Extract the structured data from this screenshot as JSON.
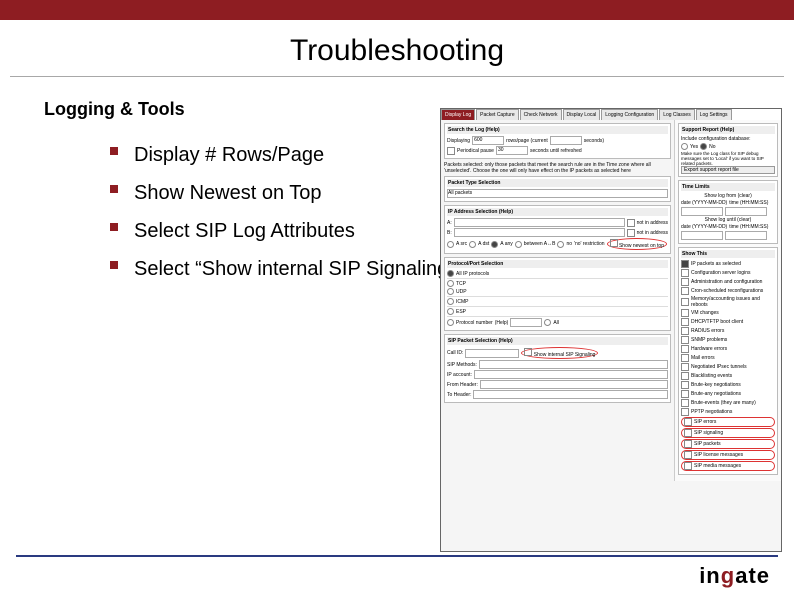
{
  "title": "Troubleshooting",
  "section": "Logging & Tools",
  "bullets": [
    "Display # Rows/Page",
    "Show Newest on Top",
    "Select SIP Log Attributes",
    "Select “Show internal SIP Signaling”"
  ],
  "scr": {
    "tabs": [
      "Display Log",
      "Packet Capture",
      "Check Network",
      "Display Local",
      "Logging Configuration",
      "Log Classes",
      "Log Settings"
    ],
    "search_title": "Search the Log",
    "displaying_label": "Displaying",
    "displaying_value": "600",
    "rows_label": "rows/page (current",
    "seconds_guess": "seconds)",
    "periodic": "Periodical pause",
    "periodic_val": "30",
    "periodic_after": "seconds until refreshed",
    "search_note": "Packets selected: only those packets that meet the search rule are in the Time zone where all 'unselected'. Choose the one will only have effect on the IP packets as selected here",
    "help": "(Help)",
    "pkt_type_title": "Packet Type Selection",
    "pkt_type_sel": "All packets",
    "ip_title": "IP Address Selection",
    "ip_a": "A:",
    "ip_b": "B:",
    "ip_chk_a": "not in address",
    "ip_chk_b": "not in address",
    "asrc": "A src",
    "adst": "A dst",
    "aany": "A any",
    "between": "between A↔B",
    "no": "no",
    "no_restrict": "'no' restriction",
    "newest": "Show newest on top",
    "proto_title": "Protocol/Port Selection",
    "all_ip": "All IP protocols",
    "tcp": "TCP",
    "udp": "UDP",
    "icmp": "ICMP",
    "esp": "ESP",
    "proto_num": "Protocol number",
    "all": "All",
    "sip_title": "SIP Packet Selection",
    "callid": "Call ID:",
    "sipm": "SIP Methods:",
    "ipacc": "IP account:",
    "fromh": "From Header:",
    "toh": "To Header:",
    "show_sip": "Show internal SIP Signaling",
    "support": {
      "title": "Support Report",
      "q": "Include configuration database:",
      "yes": "Yes",
      "no": "No",
      "note": "Make sure the Log class for SIP debug messages set to 'Local' if you want to SIP related packets.",
      "btn": "Export support report file"
    },
    "time": {
      "title": "Time Limits",
      "from": "Show log from (clear)",
      "from_date": "date (YYYY-MM-DD)",
      "from_time": "time (HH:MM:SS)",
      "until": "Show log until (clear)",
      "until_date": "date (YYYY-MM-DD)",
      "until_time": "time (HH:MM:SS)"
    },
    "show": {
      "title": "Show This",
      "items": [
        "IP packets as selected",
        "Configuration server logins",
        "Administration and configuration",
        "Cron-scheduled reconfigurations",
        "Memory/accounting issues and reboots",
        "VM changes",
        "DHCP/TFTP boot client",
        "RADIUS errors",
        "SNMP problems",
        "Hardware errors",
        "Mail errors",
        "Negotiated IPsec tunnels",
        "Blacklisting events",
        "Brute-key negotiations",
        "Brute-any negotiations",
        "Brute-events (they are many)",
        "PPTP negotiations",
        "SIP errors",
        "SIP signaling",
        "SIP packets",
        "SIP license messages",
        "SIP media messages"
      ]
    }
  },
  "logo": {
    "a": "in",
    "b": "g",
    "c": "ate"
  }
}
